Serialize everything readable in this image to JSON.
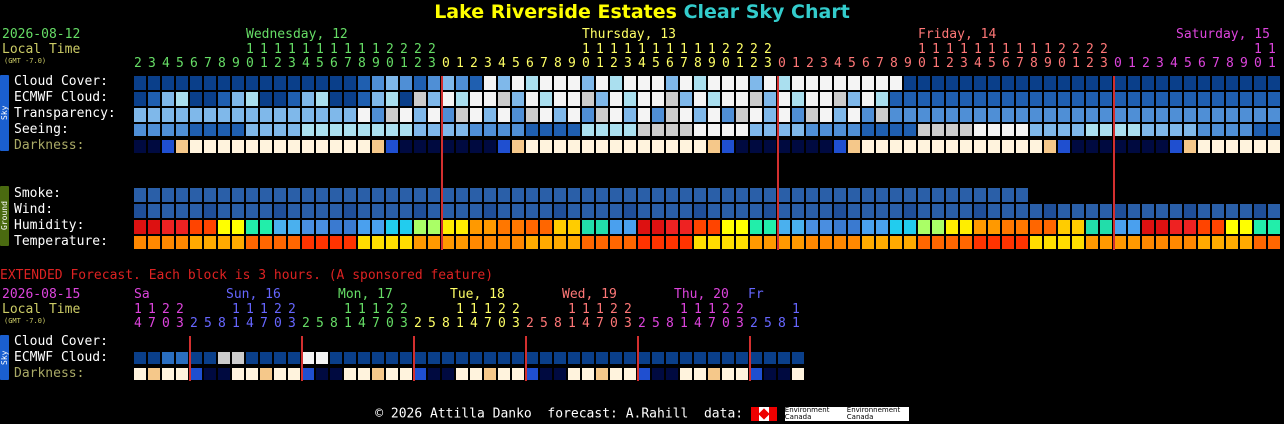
{
  "title": {
    "location": "Lake Riverside Estates",
    "chart": "Clear Sky Chart",
    "location_color": "#ffff00",
    "chart_color": "#33cccc"
  },
  "main": {
    "date": "2026-08-12",
    "local_time": "Local Time",
    "gmt": "(GMT -7.0)",
    "days": [
      {
        "label": "Wednesday, 12",
        "color": "#66dd66"
      },
      {
        "label": "Thursday, 13",
        "color": "#ffff66"
      },
      {
        "label": "Friday, 14",
        "color": "#ff7777"
      },
      {
        "label": "Saturday, 15",
        "color": "#dd44dd"
      }
    ],
    "hours": [
      2,
      3,
      4,
      5,
      6,
      7,
      8,
      9,
      10,
      11,
      12,
      13,
      14,
      15,
      16,
      17,
      18,
      19,
      20,
      21,
      22,
      23,
      0,
      1,
      2,
      3,
      4,
      5,
      6,
      7,
      8,
      9,
      10,
      11,
      12,
      13,
      14,
      15,
      16,
      17,
      18,
      19,
      20,
      21,
      22,
      23,
      0,
      1,
      2,
      3,
      4,
      5,
      6,
      7,
      8,
      9,
      10,
      11,
      12,
      13,
      14,
      15,
      16,
      17,
      18,
      19,
      20,
      21,
      22,
      23,
      0,
      1,
      2,
      3,
      4,
      5,
      6,
      7,
      8,
      9,
      10,
      11,
      12,
      13,
      14,
      15,
      16,
      17,
      18,
      19,
      20,
      21,
      22,
      23,
      0,
      1,
      2,
      3,
      4,
      5,
      6,
      7,
      8,
      9,
      10,
      11
    ],
    "sky_tag": "Sky",
    "ground_tag": "Ground",
    "rows": {
      "cloud": "Cloud Cover:",
      "ecmwf": "ECMWF Cloud:",
      "transparency": "Transparency:",
      "seeing": "Seeing:",
      "darkness": "Darkness:",
      "smoke": "Smoke:",
      "wind": "Wind:",
      "humidity": "Humidity:",
      "temperature": "Temperature:"
    }
  },
  "extended": {
    "banner": "EXTENDED Forecast. Each block is 3 hours. (A sponsored feature)",
    "date": "2026-08-15",
    "local_time": "Local Time",
    "gmt": "(GMT -7.0)",
    "days": [
      {
        "label": "Sa",
        "color": "#dd44dd"
      },
      {
        "label": "Sun, 16",
        "color": "#6666ff"
      },
      {
        "label": "Mon, 17",
        "color": "#66dd66"
      },
      {
        "label": "Tue, 18",
        "color": "#ffff66"
      },
      {
        "label": "Wed, 19",
        "color": "#ff7777"
      },
      {
        "label": "Thu, 20",
        "color": "#dd44dd"
      },
      {
        "label": "Fr",
        "color": "#6666ff"
      }
    ],
    "hours": [
      14,
      17,
      20,
      23,
      2,
      5,
      8,
      11,
      14,
      17,
      20,
      23,
      2,
      5,
      8,
      11,
      14,
      17,
      20,
      23,
      2,
      5,
      8,
      11,
      14,
      17,
      20,
      23,
      2,
      5,
      8,
      11,
      14,
      17,
      20,
      23,
      2,
      5,
      8,
      11,
      14,
      17,
      20,
      23,
      2,
      5,
      8,
      11,
      11
    ],
    "rows": {
      "cloud": "Cloud Cover:",
      "ecmwf": "ECMWF Cloud:",
      "darkness": "Darkness:"
    }
  },
  "footer": {
    "copyright": "© 2026 Attilla Danko",
    "forecast": "forecast: A.Rahill",
    "data": "data:",
    "logo1": "Environment Canada",
    "logo2": "Environnement Canada"
  }
}
